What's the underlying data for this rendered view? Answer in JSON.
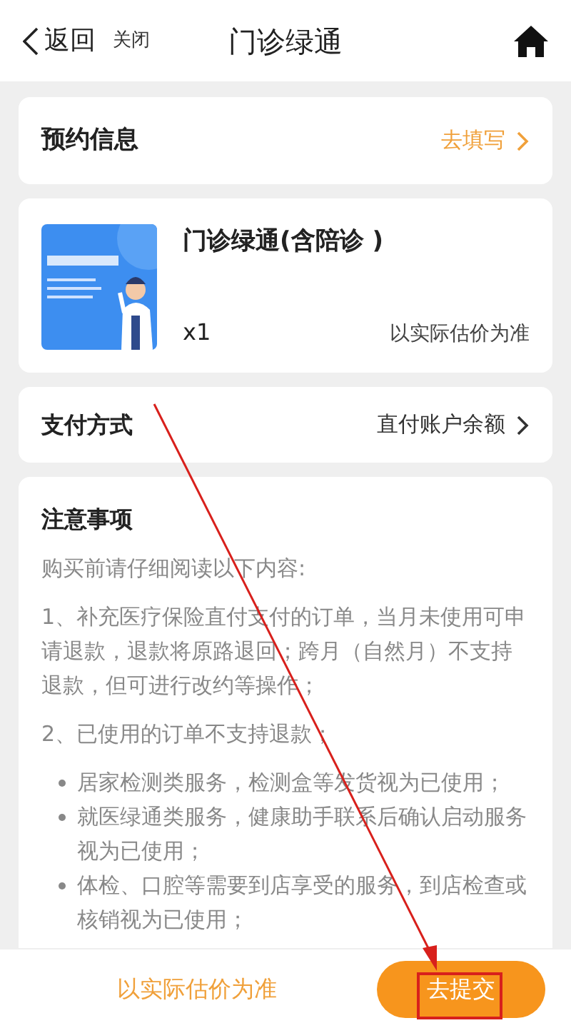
{
  "nav": {
    "back": "返回",
    "close": "关闭",
    "title": "门诊绿通"
  },
  "booking": {
    "label": "预约信息",
    "action": "去填写"
  },
  "product": {
    "name": "门诊绿通(含陪诊 )",
    "quantity": "x1",
    "price": "以实际估价为准"
  },
  "payment": {
    "label": "支付方式",
    "value": "直付账户余额"
  },
  "notes": {
    "title": "注意事项",
    "intro": "购买前请仔细阅读以下内容:",
    "paragraphs": [
      "1、补充医疗保险直付支付的订单，当月未使用可申请退款，退款将原路退回；跨月（自然月）不支持退款，但可进行改约等操作；",
      "2、已使用的订单不支持退款；"
    ],
    "bullets": [
      "居家检测类服务，检测盒等发货视为已使用；",
      "就医绿通类服务，健康助手联系后确认启动服务视为已使用；",
      "体检、口腔等需要到店享受的服务，到店检查或核销视为已使用；"
    ]
  },
  "footer": {
    "price": "以实际估价为准",
    "submit": "去提交"
  }
}
